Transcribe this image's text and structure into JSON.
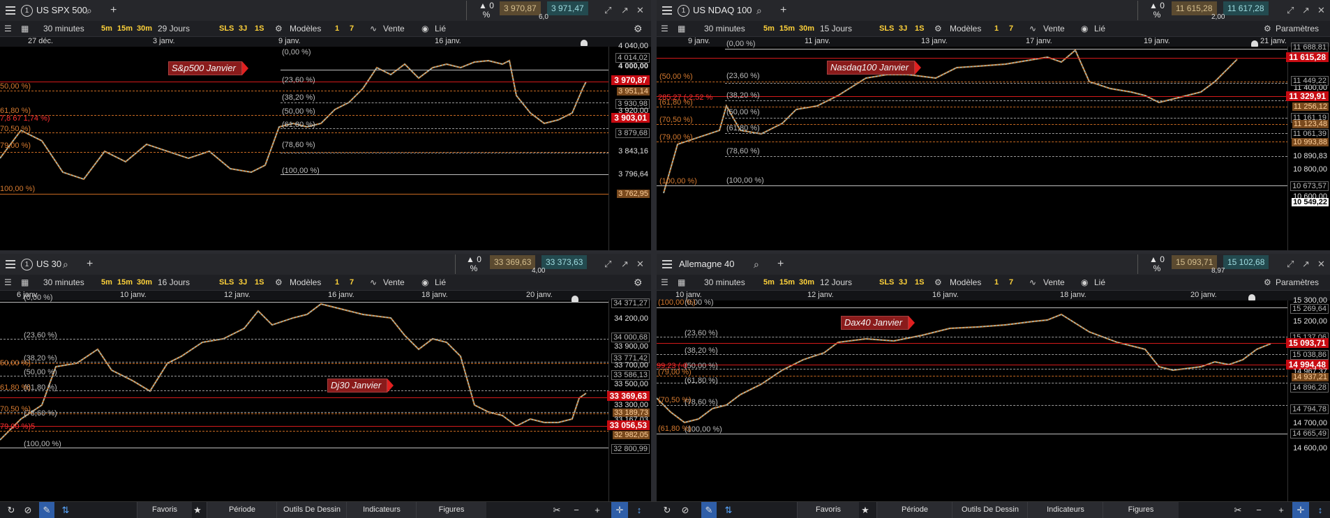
{
  "panels": [
    {
      "symbol": "US SPX 500",
      "link": "1",
      "change_pct": "0 %",
      "change_count": "0",
      "bid": "3 970,87",
      "ask": "3 971,47",
      "spread": "6,0",
      "timeframe": "30 minutes",
      "quick_tf": [
        "5m",
        "15m",
        "30m"
      ],
      "span": "29 Jours",
      "sls": "SLS",
      "r3j": "3J",
      "r1s": "1S",
      "modeles": "Modèles",
      "n1": "1",
      "n7": "7",
      "vente": "Vente",
      "lie": "Lié",
      "dates": [
        "27 déc.",
        "3 janv.",
        "9 janv.",
        "16 janv."
      ],
      "tag": "S&p500 Janvier",
      "fib_labels": [
        "(0,00 %)",
        "(23,60 %)",
        "(38,20 %)",
        "(50,00 %)",
        "(61,80 %)",
        "(78,60 %)",
        "(100,00 %)"
      ],
      "fib_left": [
        "50,00 %)",
        "61,80 %)",
        "7,8 67 1,74 %)",
        "70,50 %)",
        "79,00 %)",
        "100,00 %)"
      ],
      "axis": [
        "4 040,00",
        "4 014,02",
        "4 000,00",
        "3 970,87",
        "3 951,14",
        "3 930,98",
        "3 920,00",
        "3 903,01",
        "3 879,68",
        "3 843,16",
        "3 796,64",
        "3 762,95"
      ]
    },
    {
      "symbol": "US NDAQ 100",
      "link": "1",
      "change_pct": "0 %",
      "change_count": "0",
      "bid": "11 615,28",
      "ask": "11 617,28",
      "spread": "2,00",
      "timeframe": "30 minutes",
      "quick_tf": [
        "5m",
        "15m",
        "30m"
      ],
      "span": "15 Jours",
      "sls": "SLS",
      "r3j": "3J",
      "r1s": "1S",
      "modeles": "Modèles",
      "n1": "1",
      "n7": "7",
      "vente": "Vente",
      "lie": "Lié",
      "params": "Paramètres",
      "dates": [
        "9 janv.",
        "11 janv.",
        "13 janv.",
        "17 janv.",
        "19 janv.",
        "21 janv."
      ],
      "tag": "Nasdaq100 Janvier",
      "fib_labels": [
        "(0,00 %)",
        "(23,60 %)",
        "(38,20 %)",
        "(50,00 %)",
        "(61,80 %)",
        "(78,60 %)",
        "(100,00 %)"
      ],
      "fib_left": [
        "(50,00 %)",
        "285,27 (-2,52 %",
        "(61,80 %)",
        "(70,50 %)",
        "(79,00 %)",
        "(100,00 %)"
      ],
      "axis": [
        "11 688,81",
        "11 615,28",
        "11 400,00",
        "11 449,22",
        "11 329,91",
        "11 256,12",
        "11 161,19",
        "11 123,48",
        "11 061,39",
        "10 993,88",
        "10 890,83",
        "10 800,00",
        "10 673,57",
        "10 600,00",
        "10 549,22"
      ]
    },
    {
      "symbol": "US 30",
      "link": "1",
      "change_pct": "0 %",
      "change_count": "0",
      "bid": "33 369,63",
      "ask": "33 373,63",
      "spread": "4,00",
      "timeframe": "30 minutes",
      "quick_tf": [
        "5m",
        "15m",
        "30m"
      ],
      "span": "16 Jours",
      "sls": "SLS",
      "r3j": "3J",
      "r1s": "1S",
      "modeles": "Modèles",
      "n1": "1",
      "n7": "7",
      "vente": "Vente",
      "lie": "Lié",
      "dates": [
        "6 janv.",
        "10 janv.",
        "12 janv.",
        "16 janv.",
        "18 janv.",
        "20 janv."
      ],
      "tag": "Dj30 Janvier",
      "fib_labels": [
        "(0,00 %)",
        "(23,60 %)",
        "(38,20 %)",
        "(50,00 %)",
        "(61,80 %)",
        "(78,60 %)",
        "(100,00 %)"
      ],
      "fib_left": [
        "50,00 %)",
        "61,80 %)",
        "70,50 %)",
        "79,00 %)5"
      ],
      "axis": [
        "34 371,27",
        "34 200,00",
        "34 000,68",
        "33 900,00",
        "33 771,42",
        "33 700,00",
        "33 586,13",
        "33 500,00",
        "33 369,63",
        "33 300,00",
        "33 189,73",
        "33 167,03",
        "33 056,53",
        "32 982,05",
        "32 800,99"
      ]
    },
    {
      "symbol": "Allemagne 40",
      "link": "",
      "change_pct": "0 %",
      "change_count": "0",
      "bid": "15 093,71",
      "ask": "15 102,68",
      "spread": "8,97",
      "timeframe": "30 minutes",
      "quick_tf": [
        "5m",
        "15m",
        "30m"
      ],
      "span": "12 Jours",
      "sls": "SLS",
      "r3j": "3J",
      "r1s": "1S",
      "modeles": "Modèles",
      "n1": "1",
      "n7": "7",
      "vente": "Vente",
      "lie": "Lié",
      "params": "Paramètres",
      "dates": [
        "10 janv.",
        "12 janv.",
        "16 janv.",
        "18 janv.",
        "20 janv."
      ],
      "tag": "Dax40 Janvier",
      "fib_labels": [
        "(0,00 %)",
        "(23,60 %)",
        "(38,20 %)",
        "(50,00 %)",
        "(61,80 %)",
        "(78,60 %)",
        "(100,00 %)"
      ],
      "fib_left": [
        "(100,00 %)",
        "99,23 (-0",
        "(79,00 %)",
        "(70,50 %)",
        "(61,80 %)"
      ],
      "axis": [
        "15 300,00",
        "15 269,64",
        "15 200,00",
        "15 137,06",
        "15 093,71",
        "15 038,86",
        "14 994,48",
        "14 967,37",
        "14 937,21",
        "14 896,28",
        "14 794,78",
        "14 700,00",
        "14 665,49",
        "14 600,00"
      ]
    }
  ],
  "bottom": {
    "left": {
      "favoris": "Favoris",
      "periode": "Période",
      "outils": "Outils De Dessin",
      "indicateurs": "Indicateurs",
      "figures": "Figures"
    },
    "right": {
      "favoris": "Favoris",
      "periode": "Période",
      "outils": "Outils De Dessin",
      "indicateurs": "Indicateurs",
      "figures": "Figures"
    }
  }
}
